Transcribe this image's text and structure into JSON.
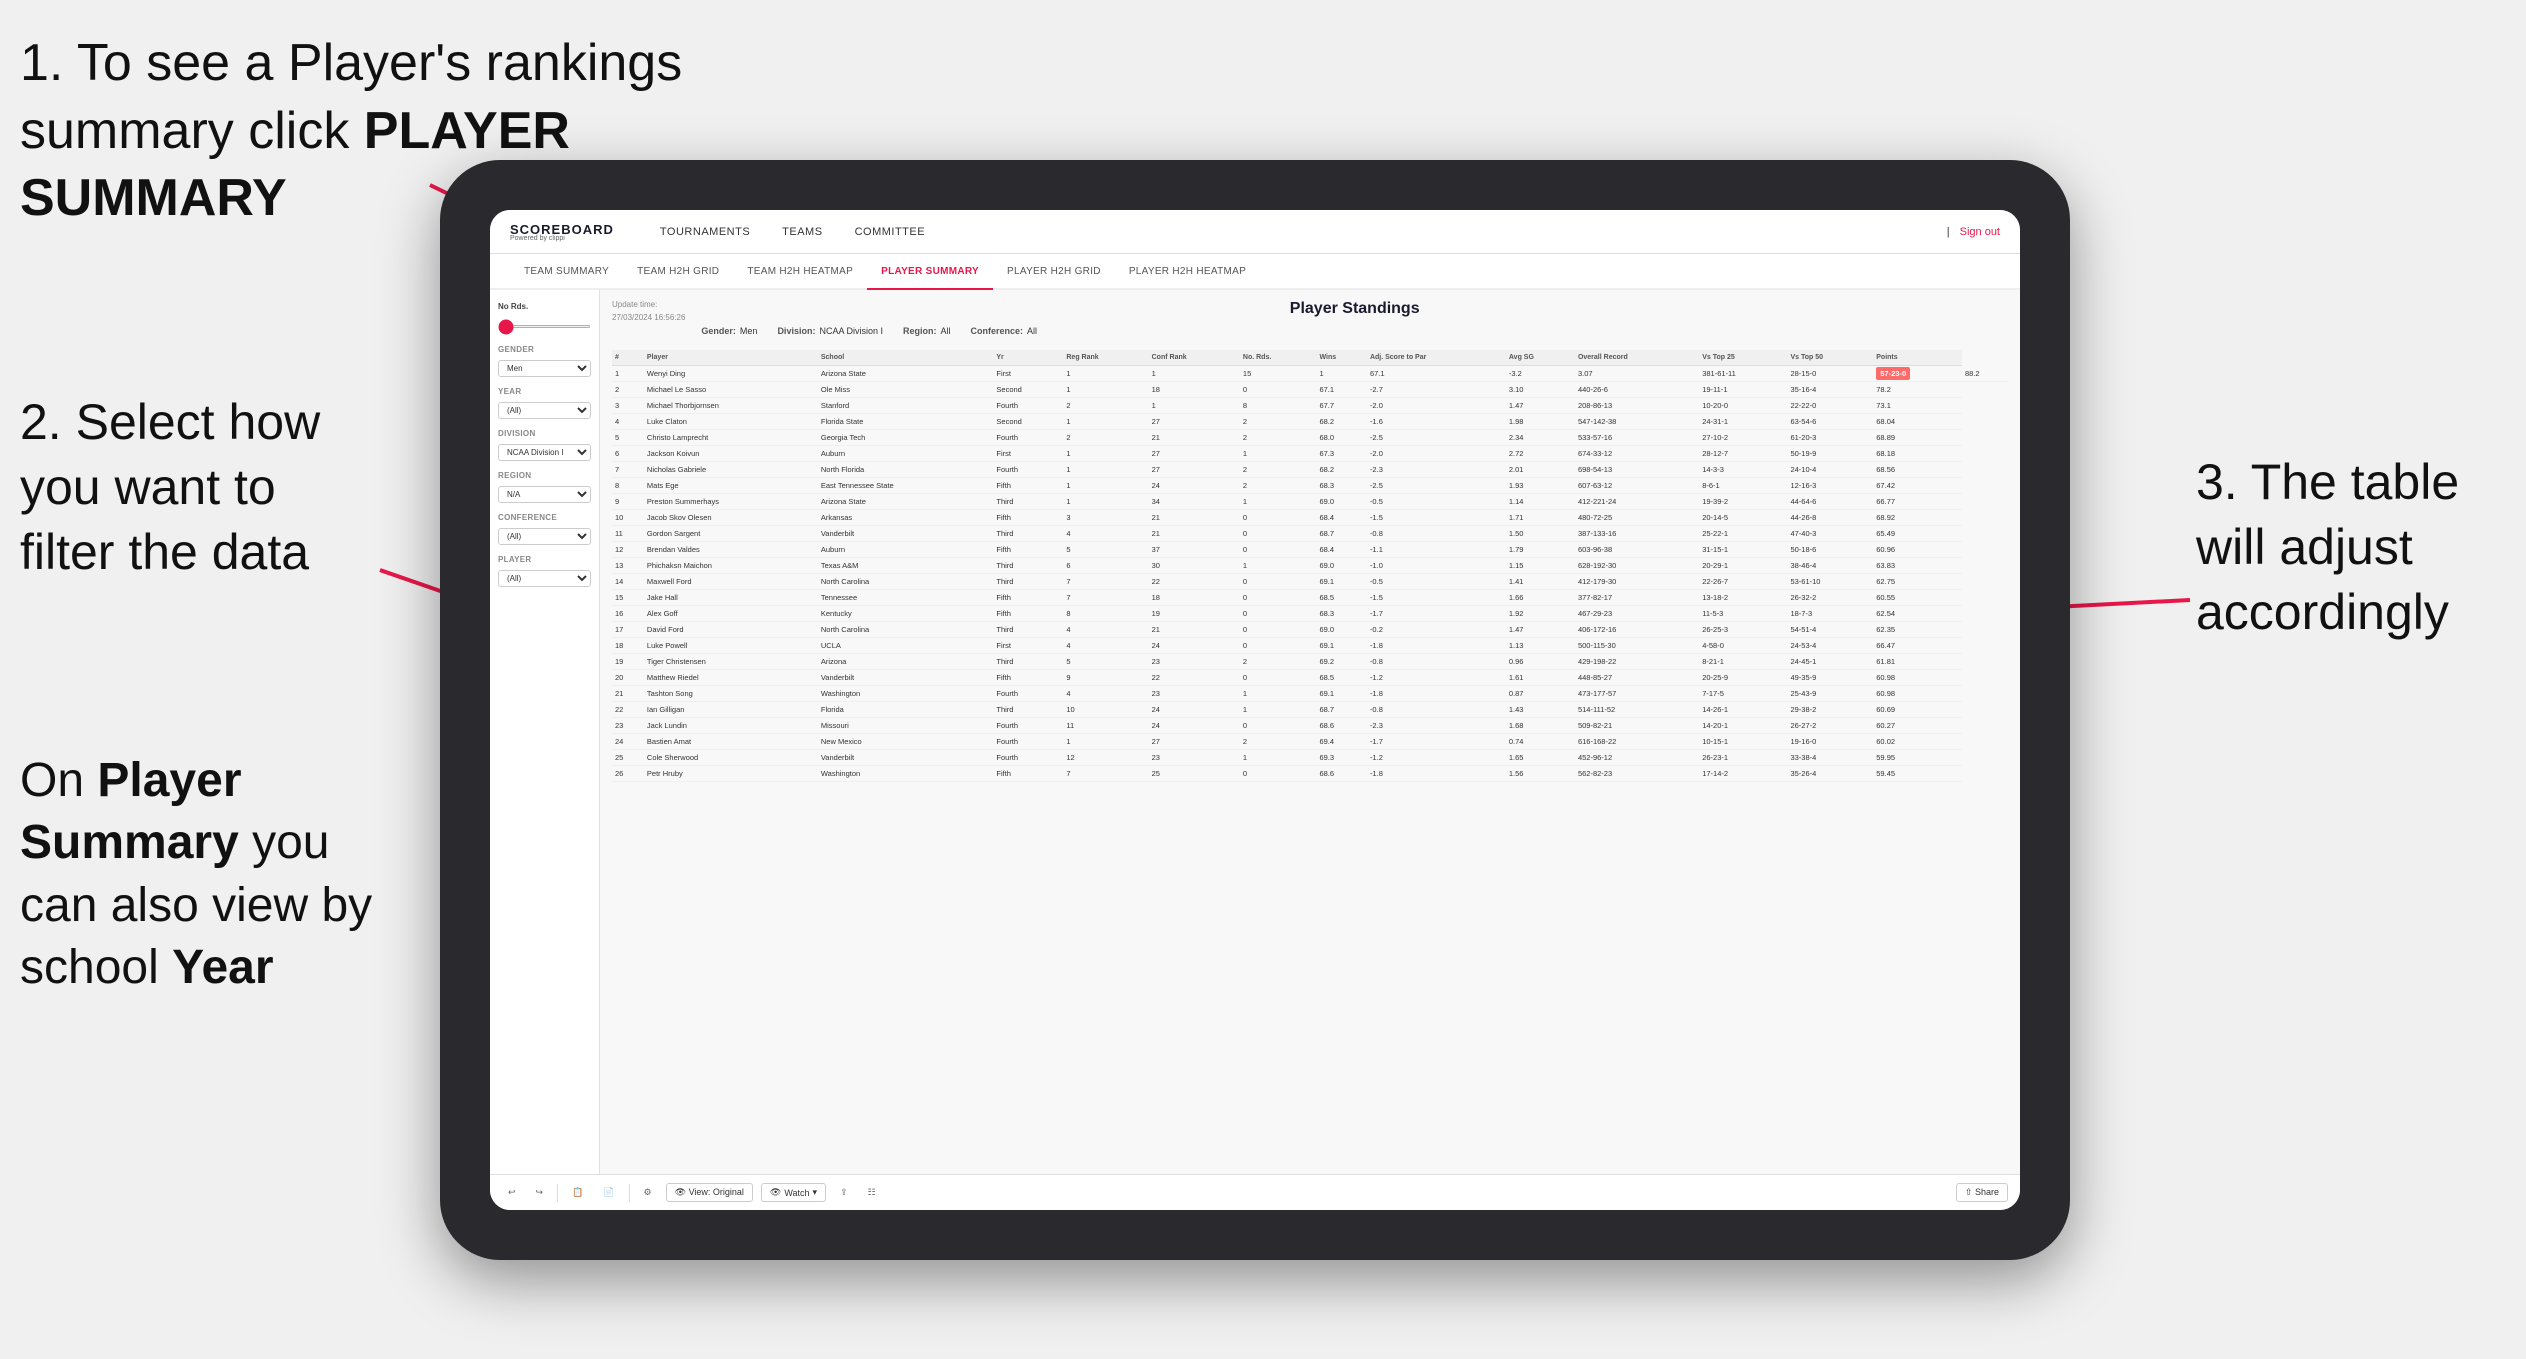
{
  "annotations": {
    "step1": "1. To see a Player's rankings summary click ",
    "step1_bold": "PLAYER SUMMARY",
    "step2_title": "2. Select how you want to filter the data",
    "step3_title": "3. The table will adjust accordingly",
    "step4_title": "On ",
    "step4_bold1": "Player Summary",
    "step4_mid": " you can also view by school ",
    "step4_bold2": "Year"
  },
  "app": {
    "logo_main": "SCOREBOARD",
    "logo_sub": "Powered by clippi",
    "sign_out": "Sign out"
  },
  "nav": {
    "items": [
      "TOURNAMENTS",
      "TEAMS",
      "COMMITTEE"
    ]
  },
  "sub_nav": {
    "items": [
      "TEAM SUMMARY",
      "TEAM H2H GRID",
      "TEAM H2H HEATMAP",
      "PLAYER SUMMARY",
      "PLAYER H2H GRID",
      "PLAYER H2H HEATMAP"
    ]
  },
  "sidebar": {
    "no_rds_label": "No Rds.",
    "gender_label": "Gender",
    "gender_value": "Men",
    "year_label": "Year",
    "year_value": "(All)",
    "division_label": "Division",
    "division_value": "NCAA Division I",
    "region_label": "Region",
    "region_value": "N/A",
    "conference_label": "Conference",
    "conference_value": "(All)",
    "player_label": "Player",
    "player_value": "(All)"
  },
  "content": {
    "update_time": "Update time:",
    "update_date": "27/03/2024 16:56:26",
    "title": "Player Standings",
    "gender_label": "Gender:",
    "gender_value": "Men",
    "division_label": "Division:",
    "division_value": "NCAA Division I",
    "region_label": "Region:",
    "region_value": "All",
    "conference_label": "Conference:",
    "conference_value": "All"
  },
  "table": {
    "headers": [
      "#",
      "Player",
      "School",
      "Yr",
      "Reg Rank",
      "Conf Rank",
      "No. Rds.",
      "Wins",
      "Adj. Score to Par",
      "Avg SG",
      "Overall Record",
      "Vs Top 25",
      "Vs Top 50",
      "Points"
    ],
    "rows": [
      [
        "1",
        "Wenyi Ding",
        "Arizona State",
        "First",
        "1",
        "1",
        "15",
        "1",
        "67.1",
        "-3.2",
        "3.07",
        "381-61-11",
        "28-15-0",
        "57-23-0",
        "88.2"
      ],
      [
        "2",
        "Michael Le Sasso",
        "Ole Miss",
        "Second",
        "1",
        "18",
        "0",
        "67.1",
        "-2.7",
        "3.10",
        "440-26-6",
        "19-11-1",
        "35-16-4",
        "78.2"
      ],
      [
        "3",
        "Michael Thorbjornsen",
        "Stanford",
        "Fourth",
        "2",
        "1",
        "8",
        "67.7",
        "-2.0",
        "1.47",
        "208-86-13",
        "10-20-0",
        "22-22-0",
        "73.1"
      ],
      [
        "4",
        "Luke Claton",
        "Florida State",
        "Second",
        "1",
        "27",
        "2",
        "68.2",
        "-1.6",
        "1.98",
        "547-142-38",
        "24-31-1",
        "63-54-6",
        "68.04"
      ],
      [
        "5",
        "Christo Lamprecht",
        "Georgia Tech",
        "Fourth",
        "2",
        "21",
        "2",
        "68.0",
        "-2.5",
        "2.34",
        "533-57-16",
        "27-10-2",
        "61-20-3",
        "68.89"
      ],
      [
        "6",
        "Jackson Koivun",
        "Auburn",
        "First",
        "1",
        "27",
        "1",
        "67.3",
        "-2.0",
        "2.72",
        "674-33-12",
        "28-12-7",
        "50-19-9",
        "68.18"
      ],
      [
        "7",
        "Nicholas Gabriele",
        "North Florida",
        "Fourth",
        "1",
        "27",
        "2",
        "68.2",
        "-2.3",
        "2.01",
        "698-54-13",
        "14-3-3",
        "24-10-4",
        "68.56"
      ],
      [
        "8",
        "Mats Ege",
        "East Tennessee State",
        "Fifth",
        "1",
        "24",
        "2",
        "68.3",
        "-2.5",
        "1.93",
        "607-63-12",
        "8-6-1",
        "12-16-3",
        "67.42"
      ],
      [
        "9",
        "Preston Summerhays",
        "Arizona State",
        "Third",
        "1",
        "34",
        "1",
        "69.0",
        "-0.5",
        "1.14",
        "412-221-24",
        "19-39-2",
        "44-64-6",
        "66.77"
      ],
      [
        "10",
        "Jacob Skov Olesen",
        "Arkansas",
        "Fifth",
        "3",
        "21",
        "0",
        "68.4",
        "-1.5",
        "1.71",
        "480-72-25",
        "20-14-5",
        "44-26-8",
        "68.92"
      ],
      [
        "11",
        "Gordon Sargent",
        "Vanderbilt",
        "Third",
        "4",
        "21",
        "0",
        "68.7",
        "-0.8",
        "1.50",
        "387-133-16",
        "25-22-1",
        "47-40-3",
        "65.49"
      ],
      [
        "12",
        "Brendan Valdes",
        "Auburn",
        "Fifth",
        "5",
        "37",
        "0",
        "68.4",
        "-1.1",
        "1.79",
        "603-96-38",
        "31-15-1",
        "50-18-6",
        "60.96"
      ],
      [
        "13",
        "Phichaksn Maichon",
        "Texas A&M",
        "Third",
        "6",
        "30",
        "1",
        "69.0",
        "-1.0",
        "1.15",
        "628-192-30",
        "20-29-1",
        "38-46-4",
        "63.83"
      ],
      [
        "14",
        "Maxwell Ford",
        "North Carolina",
        "Third",
        "7",
        "22",
        "0",
        "69.1",
        "-0.5",
        "1.41",
        "412-179-30",
        "22-26-7",
        "53-61-10",
        "62.75"
      ],
      [
        "15",
        "Jake Hall",
        "Tennessee",
        "Fifth",
        "7",
        "18",
        "0",
        "68.5",
        "-1.5",
        "1.66",
        "377-82-17",
        "13-18-2",
        "26-32-2",
        "60.55"
      ],
      [
        "16",
        "Alex Goff",
        "Kentucky",
        "Fifth",
        "8",
        "19",
        "0",
        "68.3",
        "-1.7",
        "1.92",
        "467-29-23",
        "11-5-3",
        "18-7-3",
        "62.54"
      ],
      [
        "17",
        "David Ford",
        "North Carolina",
        "Third",
        "4",
        "21",
        "0",
        "69.0",
        "-0.2",
        "1.47",
        "406-172-16",
        "26-25-3",
        "54-51-4",
        "62.35"
      ],
      [
        "18",
        "Luke Powell",
        "UCLA",
        "First",
        "4",
        "24",
        "0",
        "69.1",
        "-1.8",
        "1.13",
        "500-115-30",
        "4-58-0",
        "24-53-4",
        "66.47"
      ],
      [
        "19",
        "Tiger Christensen",
        "Arizona",
        "Third",
        "5",
        "23",
        "2",
        "69.2",
        "-0.8",
        "0.96",
        "429-198-22",
        "8-21-1",
        "24-45-1",
        "61.81"
      ],
      [
        "20",
        "Matthew Riedel",
        "Vanderbilt",
        "Fifth",
        "9",
        "22",
        "0",
        "68.5",
        "-1.2",
        "1.61",
        "448-85-27",
        "20-25-9",
        "49-35-9",
        "60.98"
      ],
      [
        "21",
        "Tashton Song",
        "Washington",
        "Fourth",
        "4",
        "23",
        "1",
        "69.1",
        "-1.8",
        "0.87",
        "473-177-57",
        "7-17-5",
        "25-43-9",
        "60.98"
      ],
      [
        "22",
        "Ian Gilligan",
        "Florida",
        "Third",
        "10",
        "24",
        "1",
        "68.7",
        "-0.8",
        "1.43",
        "514-111-52",
        "14-26-1",
        "29-38-2",
        "60.69"
      ],
      [
        "23",
        "Jack Lundin",
        "Missouri",
        "Fourth",
        "11",
        "24",
        "0",
        "68.6",
        "-2.3",
        "1.68",
        "509-82-21",
        "14-20-1",
        "26-27-2",
        "60.27"
      ],
      [
        "24",
        "Bastien Amat",
        "New Mexico",
        "Fourth",
        "1",
        "27",
        "2",
        "69.4",
        "-1.7",
        "0.74",
        "616-168-22",
        "10-15-1",
        "19-16-0",
        "60.02"
      ],
      [
        "25",
        "Cole Sherwood",
        "Vanderbilt",
        "Fourth",
        "12",
        "23",
        "1",
        "69.3",
        "-1.2",
        "1.65",
        "452-96-12",
        "26-23-1",
        "33-38-4",
        "59.95"
      ],
      [
        "26",
        "Petr Hruby",
        "Washington",
        "Fifth",
        "7",
        "25",
        "0",
        "68.6",
        "-1.8",
        "1.56",
        "562-82-23",
        "17-14-2",
        "35-26-4",
        "59.45"
      ]
    ]
  },
  "toolbar": {
    "view_label": "View: Original",
    "watch_label": "Watch",
    "share_label": "Share"
  }
}
